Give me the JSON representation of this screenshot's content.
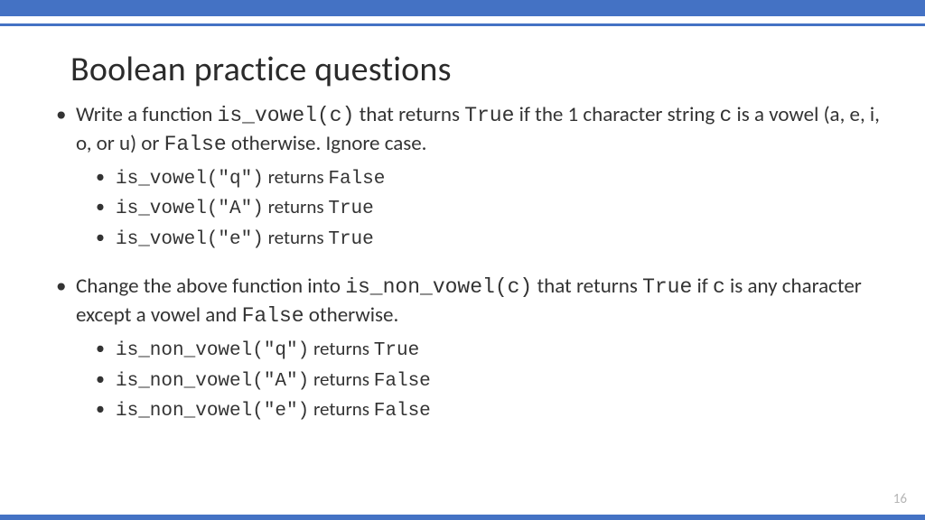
{
  "title": "Boolean practice questions",
  "page": "16",
  "b1": {
    "t1": "Write a function ",
    "c1": "is_vowel(c)",
    "t2": " that returns ",
    "c2": "True",
    "t3": " if  the 1 character string ",
    "c3": "c",
    "t4": " is a vowel (a, e, i, o, or u) or ",
    "c4": "False",
    "t5": " otherwise. Ignore case.",
    "sub": [
      {
        "c": "is_vowel(\"q\")",
        "t": " returns ",
        "r": "False"
      },
      {
        "c": "is_vowel(\"A\")",
        "t": " returns ",
        "r": "True"
      },
      {
        "c": "is_vowel(\"e\")",
        "t": " returns ",
        "r": "True"
      }
    ]
  },
  "b2": {
    "t1": "Change the above function into  ",
    "c1": "is_non_vowel(c)",
    "t2": " that returns ",
    "c2": "True",
    "t3": " if ",
    "c3": "c",
    "t4": " is any character except a vowel and ",
    "c4": "False",
    "t5": "  otherwise.",
    "sub": [
      {
        "c": "is_non_vowel(\"q\")",
        "t": " returns ",
        "r": "True"
      },
      {
        "c": "is_non_vowel(\"A\")",
        "t": " returns ",
        "r": "False"
      },
      {
        "c": "is_non_vowel(\"e\")",
        "t": " returns ",
        "r": "False"
      }
    ]
  }
}
